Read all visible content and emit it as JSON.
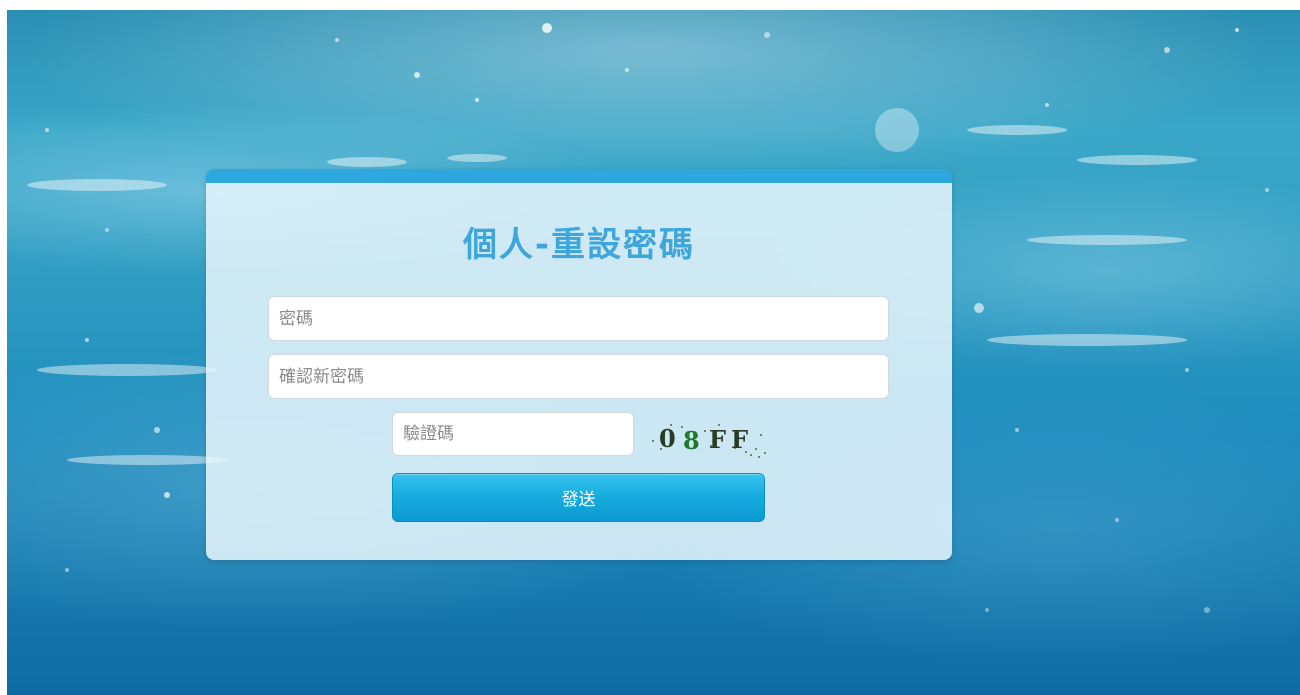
{
  "form": {
    "title": "個人-重設密碼",
    "password_placeholder": "密碼",
    "confirm_password_placeholder": "確認新密碼",
    "captcha_placeholder": "驗證碼",
    "captcha_chars": [
      "0",
      "8",
      "F",
      "F"
    ],
    "submit_label": "發送"
  },
  "colors": {
    "accent": "#2ea7df",
    "title": "#3fa6dc",
    "button": "#18addf",
    "captcha_green": "#1e7a2a",
    "captcha_dark": "#2b3a22"
  }
}
